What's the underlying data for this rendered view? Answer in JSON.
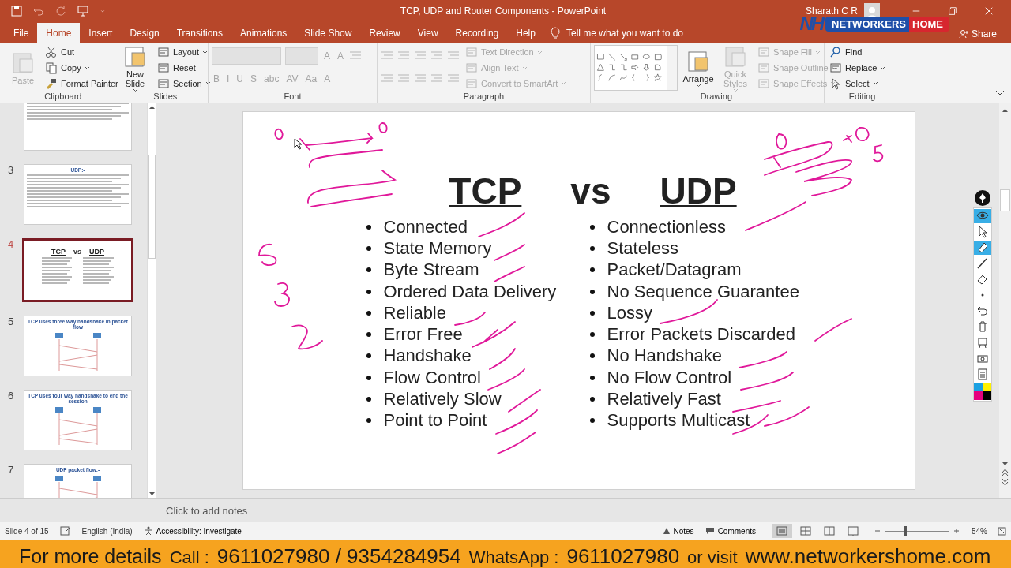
{
  "title_bar": {
    "title": "TCP, UDP and Router Components  -  PowerPoint",
    "user": "Sharath C R"
  },
  "logo_overlay": {
    "mark": "NH",
    "left": "NETWORKERS",
    "right": "HOME"
  },
  "ribbon_tabs": [
    {
      "label": "File",
      "selected": false
    },
    {
      "label": "Home",
      "selected": true
    },
    {
      "label": "Insert",
      "selected": false
    },
    {
      "label": "Design",
      "selected": false
    },
    {
      "label": "Transitions",
      "selected": false
    },
    {
      "label": "Animations",
      "selected": false
    },
    {
      "label": "Slide Show",
      "selected": false
    },
    {
      "label": "Review",
      "selected": false
    },
    {
      "label": "View",
      "selected": false
    },
    {
      "label": "Recording",
      "selected": false
    },
    {
      "label": "Help",
      "selected": false
    }
  ],
  "tell_me": "Tell me what you want to do",
  "share": "Share",
  "ribbon_groups": [
    {
      "label": "Clipboard",
      "columns": [
        [
          {
            "kind": "large",
            "label": "Paste",
            "disabled": true
          }
        ],
        [
          {
            "kind": "small",
            "label": "Cut",
            "disabled": false
          },
          {
            "kind": "small",
            "label": "Copy",
            "disabled": false,
            "dropdown": true
          },
          {
            "kind": "small",
            "label": "Format Painter",
            "disabled": false
          }
        ]
      ]
    },
    {
      "label": "Slides",
      "columns": [
        [
          {
            "kind": "large",
            "label": "New Slide",
            "disabled": false,
            "dropdown": true
          }
        ],
        [
          {
            "kind": "small",
            "label": "Layout",
            "disabled": false,
            "dropdown": true
          },
          {
            "kind": "small",
            "label": "Reset",
            "disabled": false
          },
          {
            "kind": "small",
            "label": "Section",
            "disabled": false,
            "dropdown": true
          }
        ]
      ]
    },
    {
      "label": "Font",
      "columns": [
        [
          {
            "kind": "strip",
            "items": [
              {
                "kind": "field",
                "disabled": true
              },
              {
                "kind": "field",
                "disabled": true
              },
              {
                "kind": "glyph",
                "label": "A",
                "disabled": true
              },
              {
                "kind": "glyph",
                "label": "A",
                "disabled": true
              },
              {
                "kind": "icon",
                "disabled": true
              }
            ]
          },
          {
            "kind": "strip",
            "items": [
              {
                "kind": "glyph",
                "label": "B",
                "disabled": true
              },
              {
                "kind": "glyph",
                "label": "I",
                "disabled": true
              },
              {
                "kind": "glyph",
                "label": "U",
                "disabled": true
              },
              {
                "kind": "glyph",
                "label": "S",
                "disabled": true
              },
              {
                "kind": "glyph",
                "label": "abc",
                "disabled": true
              },
              {
                "kind": "glyph",
                "label": "AV",
                "disabled": true
              },
              {
                "kind": "glyph",
                "label": "Aa",
                "disabled": true
              },
              {
                "kind": "glyph",
                "label": "A",
                "disabled": true
              }
            ]
          }
        ]
      ]
    },
    {
      "label": "Paragraph",
      "columns": [
        [
          {
            "kind": "strip",
            "items": [
              {
                "kind": "icon",
                "disabled": true
              },
              {
                "kind": "icon",
                "disabled": true
              },
              {
                "kind": "icon",
                "disabled": true
              },
              {
                "kind": "icon",
                "disabled": true
              },
              {
                "kind": "icon",
                "disabled": true
              }
            ]
          },
          {
            "kind": "strip",
            "items": [
              {
                "kind": "icon",
                "disabled": true
              },
              {
                "kind": "icon",
                "disabled": true
              },
              {
                "kind": "icon",
                "disabled": true
              },
              {
                "kind": "icon",
                "disabled": true
              },
              {
                "kind": "icon",
                "disabled": true
              }
            ]
          }
        ],
        [
          {
            "kind": "small",
            "label": "Text Direction",
            "disabled": true,
            "dropdown": true
          },
          {
            "kind": "small",
            "label": "Align Text",
            "disabled": true,
            "dropdown": true
          },
          {
            "kind": "small",
            "label": "Convert to SmartArt",
            "disabled": true,
            "dropdown": true
          }
        ]
      ]
    },
    {
      "label": "Drawing",
      "columns": [
        [
          {
            "kind": "gallery"
          }
        ],
        [
          {
            "kind": "large",
            "label": "Arrange",
            "disabled": false,
            "dropdown": true
          }
        ],
        [
          {
            "kind": "large",
            "label": "Quick Styles",
            "disabled": true,
            "dropdown": true
          }
        ],
        [
          {
            "kind": "small",
            "label": "Shape Fill",
            "disabled": true,
            "dropdown": true
          },
          {
            "kind": "small",
            "label": "Shape Outline",
            "disabled": true,
            "dropdown": true
          },
          {
            "kind": "small",
            "label": "Shape Effects",
            "disabled": true,
            "dropdown": true
          }
        ]
      ]
    },
    {
      "label": "Editing",
      "columns": [
        [
          {
            "kind": "small",
            "label": "Find",
            "disabled": false
          },
          {
            "kind": "small",
            "label": "Replace",
            "disabled": false,
            "dropdown": true
          },
          {
            "kind": "small",
            "label": "Select",
            "disabled": false,
            "dropdown": true
          }
        ]
      ]
    }
  ],
  "thumbnails": [
    {
      "kind": "text",
      "selected": false
    },
    {
      "number": "3",
      "kind": "text",
      "title": "UDP:-",
      "selected": false
    },
    {
      "number": "4",
      "kind": "comparison",
      "title_parts": [
        "TCP",
        "vs",
        "UDP"
      ],
      "selected": true
    },
    {
      "number": "5",
      "kind": "diagram",
      "title": "TCP uses three way handshake in packet flow",
      "selected": false
    },
    {
      "number": "6",
      "kind": "diagram",
      "title": "TCP uses four way handshake to end the session",
      "selected": false
    },
    {
      "number": "7",
      "kind": "diagram",
      "title": "UDP packet flow:-",
      "selected": false
    }
  ],
  "slide": {
    "left_heading": "TCP",
    "middle": "vs",
    "right_heading": "UDP",
    "left_items": [
      "Connected",
      "State Memory",
      "Byte Stream",
      "Ordered Data Delivery",
      "Reliable",
      "Error Free",
      "Handshake",
      "Flow Control",
      "Relatively Slow",
      "Point to Point"
    ],
    "right_items": [
      "Connectionless",
      "Stateless",
      "Packet/Datagram",
      "No Sequence Guarantee",
      "Lossy",
      "Error Packets Discarded",
      "No Handshake",
      "No Flow Control",
      "Relatively Fast",
      "Supports Multicast"
    ]
  },
  "pen_toolbar": {
    "tools": [
      {
        "kind": "eye",
        "selected": true
      },
      {
        "kind": "pointer",
        "selected": false
      },
      {
        "kind": "highlighter",
        "selected": true
      },
      {
        "kind": "pen",
        "selected": false
      },
      {
        "kind": "eraser",
        "selected": false
      },
      {
        "kind": "dot",
        "selected": false
      },
      {
        "kind": "undo",
        "selected": false
      },
      {
        "kind": "trash",
        "selected": false
      },
      {
        "kind": "board",
        "selected": false
      },
      {
        "kind": "camera",
        "selected": false
      },
      {
        "kind": "clipboard",
        "selected": false
      }
    ],
    "palette": [
      {
        "color": "#1ba1e2"
      },
      {
        "color": "#fff200"
      },
      {
        "color": "#e6007e"
      },
      {
        "color": "#000000"
      }
    ]
  },
  "notes": {
    "placeholder": "Click to add notes"
  },
  "status_bar": {
    "slide": "Slide 4 of 15",
    "language": "English (India)",
    "accessibility": "Accessibility: Investigate",
    "notes": "Notes",
    "comments": "Comments",
    "views": [
      {
        "selected": true
      },
      {
        "selected": false
      },
      {
        "selected": false
      },
      {
        "selected": false
      }
    ],
    "zoom": {
      "level": 0.3,
      "reading": "54%"
    }
  },
  "banner": {
    "lead": "For more details",
    "call_label": "Call :",
    "call_numbers": "9611027980 / 9354284954",
    "whatsapp_label": "WhatsApp :",
    "whatsapp_number": "9611027980",
    "visit_label": "or visit",
    "website": "www.networkershome.com"
  }
}
